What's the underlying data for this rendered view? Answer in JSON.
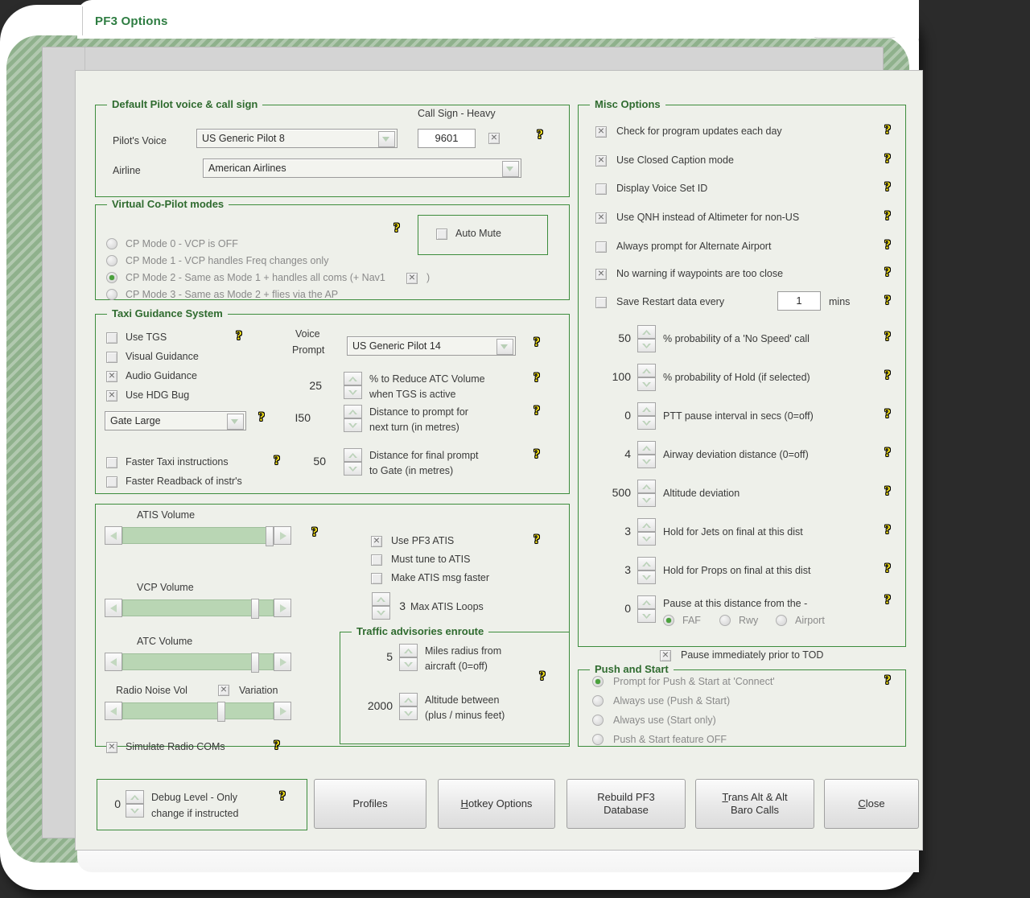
{
  "window": {
    "title": "PF3 Options"
  },
  "pilot_group": {
    "caption": "Default Pilot voice & call sign",
    "voice_label": "Pilot's Voice",
    "voice_value": "US Generic Pilot 8",
    "airline_label": "Airline",
    "airline_value": "American Airlines",
    "callsign_label": "Call Sign - Heavy",
    "callsign_value": "9601",
    "heavy_checked": true,
    "help": "?"
  },
  "vcp_group": {
    "caption": "Virtual Co-Pilot modes",
    "help": "?",
    "auto_mute_label": "Auto Mute",
    "auto_mute_checked": false,
    "modes": [
      {
        "label": "CP Mode 0 - VCP is OFF",
        "selected": false
      },
      {
        "label": "CP Mode 1 - VCP handles Freq changes only",
        "selected": false
      },
      {
        "label": "CP Mode 2 - Same as Mode 1 + handles all coms (+ Nav1",
        "selected": true,
        "suffix": ")"
      },
      {
        "label": "CP Mode 3 - Same as Mode 2 + flies via the AP",
        "selected": false
      }
    ],
    "nav1_checked": true
  },
  "tgs_group": {
    "caption": "Taxi Guidance System",
    "checks": [
      {
        "label": "Use TGS",
        "checked": false
      },
      {
        "label": "Visual Guidance",
        "checked": false
      },
      {
        "label": "Audio Guidance",
        "checked": true
      },
      {
        "label": "Use HDG Bug",
        "checked": true
      }
    ],
    "voice_prompt_label_1": "Voice",
    "voice_prompt_label_2": "Prompt",
    "voice_prompt_value": "US Generic Pilot 14",
    "gate_value": "Gate Large",
    "reduce_vol_value": "25",
    "reduce_vol_text_1": "% to Reduce ATC Volume",
    "reduce_vol_text_2": "when TGS is active",
    "next_turn_value": "I50",
    "next_turn_text_1": "Distance to prompt for",
    "next_turn_text_2": "next turn (in metres)",
    "final_prompt_value": "50",
    "final_prompt_text_1": "Distance for final prompt",
    "final_prompt_text_2": "to Gate (in metres)",
    "faster_taxi_label": "Faster Taxi instructions",
    "faster_taxi_checked": false,
    "faster_readback_label": "Faster Readback of instr's",
    "faster_readback_checked": false,
    "help": "?"
  },
  "audio_group": {
    "sliders": [
      {
        "label": "ATIS Volume",
        "percent": 100
      },
      {
        "label": "VCP Volume",
        "percent": 92
      },
      {
        "label": "ATC Volume",
        "percent": 92
      },
      {
        "label": "Radio Noise Vol",
        "percent": 72
      }
    ],
    "variation_label": "Variation",
    "variation_checked": true,
    "simulate_label": "Simulate Radio COMs",
    "simulate_checked": true,
    "atis_checks": [
      {
        "label": "Use PF3 ATIS",
        "checked": true
      },
      {
        "label": "Must tune to ATIS",
        "checked": false
      },
      {
        "label": "Make ATIS msg faster",
        "checked": false
      }
    ],
    "max_atis_loops_value": "3",
    "max_atis_loops_label": "Max ATIS Loops",
    "help": "?"
  },
  "traffic_group": {
    "caption": "Traffic advisories enroute",
    "miles_value": "5",
    "miles_text_1": "Miles radius from",
    "miles_text_2": "aircraft (0=off)",
    "alt_value": "2000",
    "alt_text_1": "Altitude between",
    "alt_text_2": "(plus / minus feet)",
    "help": "?"
  },
  "misc_group": {
    "caption": "Misc Options",
    "checks": [
      {
        "label": "Check for program updates each day",
        "checked": true
      },
      {
        "label": "Use Closed Caption mode",
        "checked": true
      },
      {
        "label": "Display Voice Set ID",
        "checked": false
      },
      {
        "label": "Use QNH instead of Altimeter for non-US",
        "checked": true
      },
      {
        "label": "Always prompt for Alternate Airport",
        "checked": false
      },
      {
        "label": "No warning if waypoints are too close",
        "checked": true
      }
    ],
    "save_restart_label": "Save Restart data every",
    "save_restart_checked": false,
    "save_restart_value": "1",
    "save_restart_units": "mins",
    "spinners": [
      {
        "value": "50",
        "label": "% probability of a 'No Speed' call"
      },
      {
        "value": "100",
        "label": "% probability of Hold (if selected)"
      },
      {
        "value": "0",
        "label": "PTT pause interval in secs (0=off)"
      },
      {
        "value": "4",
        "label": "Airway deviation distance (0=off)"
      },
      {
        "value": "500",
        "label": "Altitude deviation"
      },
      {
        "value": "3",
        "label": "Hold for Jets on final at this dist"
      },
      {
        "value": "3",
        "label": "Hold for Props on final at this dist"
      },
      {
        "value": "0",
        "label": "Pause at this distance from the -"
      }
    ],
    "pause_radios": [
      {
        "label": "FAF",
        "selected": true
      },
      {
        "label": "Rwy",
        "selected": false
      },
      {
        "label": "Airport",
        "selected": false
      }
    ],
    "pause_tod_label": "Pause immediately prior to TOD",
    "pause_tod_checked": true,
    "help": "?"
  },
  "push_group": {
    "caption": "Push and Start",
    "options": [
      {
        "label": "Prompt for Push & Start at 'Connect'",
        "selected": true
      },
      {
        "label": "Always use (Push & Start)",
        "selected": false
      },
      {
        "label": "Always use (Start only)",
        "selected": false
      },
      {
        "label": "Push & Start feature OFF",
        "selected": false
      }
    ],
    "help": "?"
  },
  "footer": {
    "debug_value": "0",
    "debug_text_1": "Debug Level - Only",
    "debug_text_2": "change if instructed",
    "help": "?",
    "buttons": [
      {
        "name": "profiles",
        "pre": "",
        "accel": "",
        "post": "Profiles"
      },
      {
        "name": "hotkey",
        "pre": "",
        "accel": "H",
        "post": "otkey Options"
      },
      {
        "name": "rebuild",
        "line1": "Rebuild PF3",
        "line2": "Database"
      },
      {
        "name": "transalt",
        "accel": "T",
        "line1rest": "rans Alt & Alt",
        "line2": "Baro Calls"
      },
      {
        "name": "close",
        "pre": "",
        "accel": "C",
        "post": "lose"
      }
    ]
  },
  "colors": {
    "group_border": "#3c8c3c",
    "caption_text": "#2f6b2f",
    "dialog_bg": "#eef0ea",
    "title_text": "#2e7d42",
    "slider_track": "#b9d6b4",
    "radio_dot": "#4aa13c",
    "help_icon": "#f5e21c"
  }
}
